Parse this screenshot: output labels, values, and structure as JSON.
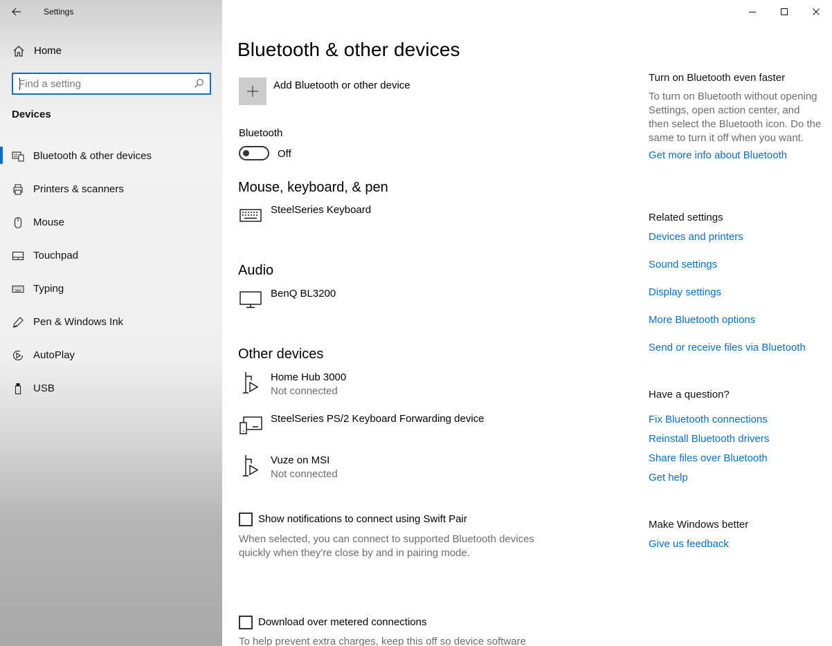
{
  "window": {
    "title": "Settings"
  },
  "sidebar": {
    "home_label": "Home",
    "search_placeholder": "Find a setting",
    "section": "Devices",
    "items": [
      {
        "label": "Bluetooth & other devices",
        "icon": "bluetooth-devices-icon",
        "active": true
      },
      {
        "label": "Printers & scanners",
        "icon": "printer-icon"
      },
      {
        "label": "Mouse",
        "icon": "mouse-icon"
      },
      {
        "label": "Touchpad",
        "icon": "touchpad-icon"
      },
      {
        "label": "Typing",
        "icon": "keyboard-icon"
      },
      {
        "label": "Pen & Windows Ink",
        "icon": "pen-icon"
      },
      {
        "label": "AutoPlay",
        "icon": "autoplay-icon"
      },
      {
        "label": "USB",
        "icon": "usb-icon"
      }
    ]
  },
  "main": {
    "title": "Bluetooth & other devices",
    "add_device_label": "Add Bluetooth or other device",
    "bluetooth_label": "Bluetooth",
    "bluetooth_state": "Off",
    "groups": {
      "input": {
        "title": "Mouse, keyboard, & pen",
        "devices": [
          {
            "name": "SteelSeries Keyboard",
            "status": "",
            "icon": "keyboard-icon"
          }
        ]
      },
      "audio": {
        "title": "Audio",
        "devices": [
          {
            "name": "BenQ BL3200",
            "status": "",
            "icon": "monitor-icon"
          }
        ]
      },
      "other": {
        "title": "Other devices",
        "devices": [
          {
            "name": "Home Hub 3000",
            "status": "Not connected",
            "icon": "media-device-icon"
          },
          {
            "name": "SteelSeries PS/2 Keyboard Forwarding device",
            "status": "",
            "icon": "generic-device-icon"
          },
          {
            "name": "Vuze on MSI",
            "status": "Not connected",
            "icon": "media-device-icon"
          }
        ]
      }
    },
    "swift_pair": {
      "label": "Show notifications to connect using Swift Pair",
      "checked": false,
      "description": "When selected, you can connect to supported Bluetooth devices quickly when they're close by and in pairing mode."
    },
    "metered": {
      "label": "Download over metered connections",
      "checked": false,
      "description": "To help prevent extra charges, keep this off so device software"
    }
  },
  "right": {
    "faster": {
      "heading": "Turn on Bluetooth even faster",
      "text": "To turn on Bluetooth without opening Settings, open action center, and then select the Bluetooth icon. Do the same to turn it off when you want.",
      "link": "Get more info about Bluetooth"
    },
    "related": {
      "heading": "Related settings",
      "links": [
        "Devices and printers",
        "Sound settings",
        "Display settings",
        "More Bluetooth options",
        "Send or receive files via Bluetooth"
      ]
    },
    "question": {
      "heading": "Have a question?",
      "links": [
        "Fix Bluetooth connections",
        "Reinstall Bluetooth drivers",
        "Share files over Bluetooth",
        "Get help"
      ]
    },
    "better": {
      "heading": "Make Windows better",
      "link": "Give us feedback"
    }
  },
  "colors": {
    "accent": "#0a6ec8",
    "secondary_text": "#6d6d6d",
    "tile": "#cccccc"
  }
}
